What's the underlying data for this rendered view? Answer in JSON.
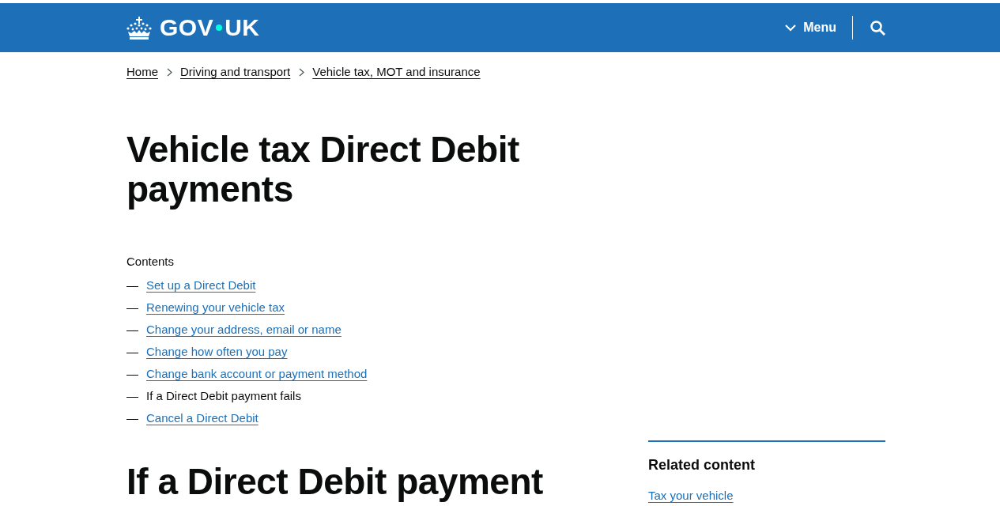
{
  "header": {
    "logo": {
      "text_before_dot": "GOV",
      "text_after_dot": "UK"
    },
    "menu_button": {
      "label": "Menu",
      "expanded": false
    }
  },
  "breadcrumbs": [
    "Home",
    "Driving and transport",
    "Vehicle tax, MOT and insurance"
  ],
  "title": "Vehicle tax Direct Debit payments",
  "contents": {
    "heading": "Contents",
    "items": [
      {
        "marker": "—",
        "label": "Set up a Direct Debit",
        "selected": false
      },
      {
        "marker": "—",
        "label": "Renewing your vehicle tax",
        "selected": false
      },
      {
        "marker": "—",
        "label": "Change your address, email or name",
        "selected": false
      },
      {
        "marker": "—",
        "label": "Change how often you pay",
        "selected": false
      },
      {
        "marker": "—",
        "label": "Change bank account or payment method",
        "selected": false
      },
      {
        "marker": "—",
        "label": "If a Direct Debit payment fails",
        "selected": true
      },
      {
        "marker": "—",
        "label": "Cancel a Direct Debit",
        "selected": false
      }
    ]
  },
  "section": {
    "heading": "If a Direct Debit payment"
  },
  "related_content": {
    "heading": "Related content",
    "links": [
      "Tax your vehicle"
    ]
  }
}
